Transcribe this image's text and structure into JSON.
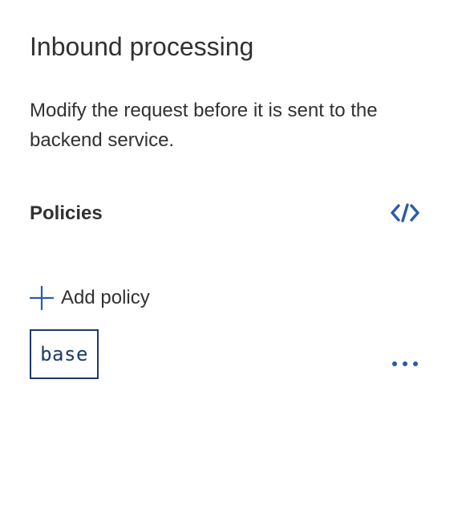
{
  "panel": {
    "title": "Inbound processing",
    "description": "Modify the request before it is sent to the backend service."
  },
  "policies": {
    "heading": "Policies",
    "code_view_icon": "code-icon",
    "add_policy_label": "Add policy",
    "add_policy_icon": "plus-icon",
    "items": [
      {
        "label": "base",
        "more_icon": "ellipsis-icon"
      }
    ]
  },
  "colors": {
    "accent": "#2b5aa8",
    "chip_border": "#1b3a6b",
    "text": "#323130"
  }
}
